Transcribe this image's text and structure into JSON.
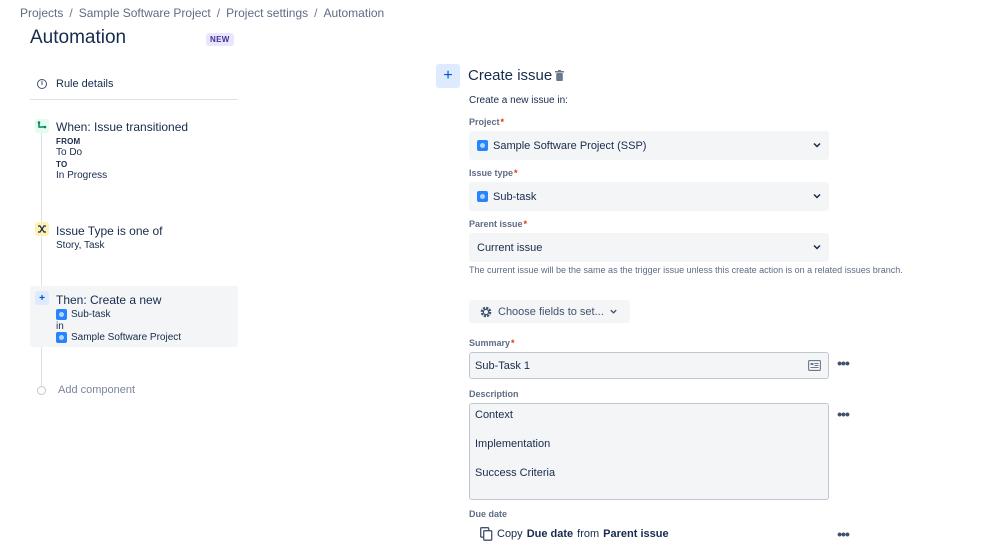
{
  "breadcrumb": [
    {
      "label": "Projects"
    },
    {
      "label": "Sample Software Project"
    },
    {
      "label": "Project settings"
    },
    {
      "label": "Automation"
    }
  ],
  "breadcrumb_separator": "/",
  "page": {
    "title": "Automation",
    "badge": "NEW"
  },
  "rule": {
    "details_label": "Rule details",
    "trigger": {
      "title": "When: Issue transitioned",
      "from_label": "FROM",
      "from_value": "To Do",
      "to_label": "TO",
      "to_value": "In Progress"
    },
    "condition": {
      "title": "Issue Type is one of",
      "value": "Story, Task"
    },
    "action": {
      "title": "Then: Create a new",
      "issue_type": "Sub-task",
      "in_label": "in",
      "project": "Sample Software Project"
    },
    "add_component_label": "Add component"
  },
  "panel": {
    "title": "Create issue",
    "subtitle": "Create a new issue in:",
    "project": {
      "label": "Project",
      "required": "*",
      "value": "Sample Software Project (SSP)"
    },
    "issue_type": {
      "label": "Issue type",
      "required": "*",
      "value": "Sub-task"
    },
    "parent_issue": {
      "label": "Parent issue",
      "required": "*",
      "value": "Current issue"
    },
    "hint": "The current issue will be the same as the trigger issue unless this create action is on a related issues branch.",
    "choose_fields_label": "Choose fields to set...",
    "summary": {
      "label": "Summary",
      "required": "*",
      "value": "Sub-Task 1"
    },
    "description": {
      "label": "Description",
      "lines": [
        "Context",
        "Implementation",
        "Success Criteria"
      ]
    },
    "due_date": {
      "label": "Due date",
      "copy_prefix": "Copy",
      "field": "Due date",
      "from_word": "from",
      "source": "Parent issue"
    }
  },
  "more_label": "•••",
  "colors": {
    "accent": "#0052cc",
    "required": "#de350b",
    "text": "#172b4d",
    "subtle": "#5e6c84"
  }
}
